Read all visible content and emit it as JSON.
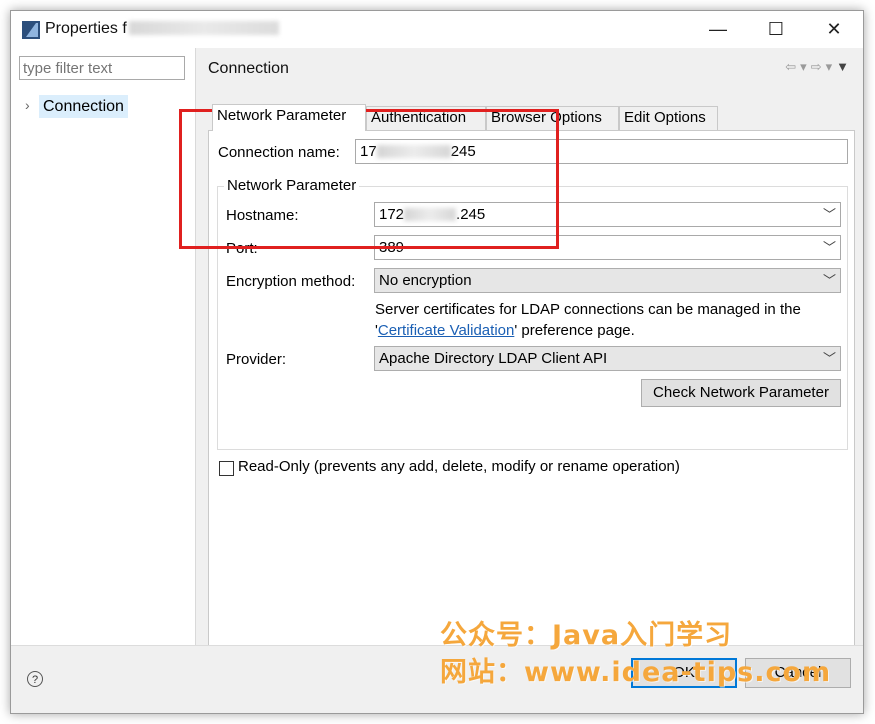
{
  "window": {
    "title": "Properties f",
    "controls": {
      "minimize": "—",
      "maximize": "☐",
      "close": "✕"
    }
  },
  "left": {
    "filter_placeholder": "type filter text",
    "tree": [
      {
        "label": "Connection",
        "selected": true
      }
    ]
  },
  "page": {
    "title": "Connection",
    "tabs": [
      {
        "label": "Network Parameter",
        "active": true
      },
      {
        "label": "Authentication"
      },
      {
        "label": "Browser Options"
      },
      {
        "label": "Edit Options"
      }
    ],
    "connection_name": {
      "label": "Connection name:",
      "value_prefix": "17",
      "value_suffix": "245"
    },
    "group_title": "Network Parameter",
    "hostname": {
      "label": "Hostname:",
      "value_prefix": "172",
      "value_suffix": ".245"
    },
    "port": {
      "label": "Port:",
      "value": "389"
    },
    "encryption": {
      "label": "Encryption method:",
      "value": "No encryption"
    },
    "cert_text_1": "Server certificates for LDAP connections can be managed in the",
    "cert_text_2a": "'",
    "cert_link": "Certificate Validation",
    "cert_text_2b": "' preference page.",
    "provider": {
      "label": "Provider:",
      "value": "Apache Directory LDAP Client API"
    },
    "check_button": "Check Network Parameter",
    "readonly_label": "Read-Only (prevents any add, delete, modify or rename operation)"
  },
  "footer": {
    "help": "?",
    "ok": "OK",
    "cancel": "Cancel"
  },
  "watermark": {
    "line1": "公众号：Java入门学习",
    "line2": "网站：www.idea-tips.com"
  },
  "colors": {
    "highlight": "#e0201f",
    "watermark": "#f5a73c",
    "accent": "#0078d7"
  }
}
